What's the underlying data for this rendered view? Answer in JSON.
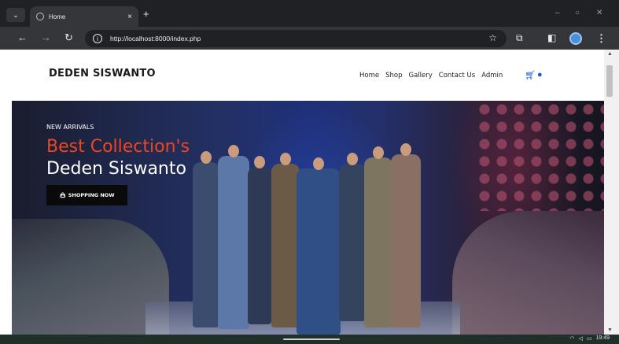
{
  "browser": {
    "tab_title": "Home",
    "tab_close": "×",
    "new_tab": "+",
    "url": "http://localhost:8000/index.php",
    "icons": [
      "tab-switcher-icon",
      "globe-icon",
      "back-icon",
      "forward-icon",
      "reload-icon",
      "info-icon",
      "star-icon",
      "extensions-icon",
      "sidepanel-icon",
      "profile-icon",
      "menu-icon"
    ]
  },
  "site": {
    "logo": "DEDEN SISWANTO",
    "nav": [
      "Home",
      "Shop",
      "Gallery",
      "Contact Us",
      "Admin"
    ],
    "hero": {
      "eyebrow": "NEW ARRIVALS",
      "headline_1": "Best Collection's",
      "headline_2": "Deden Siswanto",
      "cta": "SHOPPING NOW"
    },
    "colors": {
      "accent": "#f0451f",
      "nav_icon": "#1a56d6",
      "cta_bg": "#0a0a0a"
    }
  },
  "taskbar": {
    "time": "19:49"
  }
}
